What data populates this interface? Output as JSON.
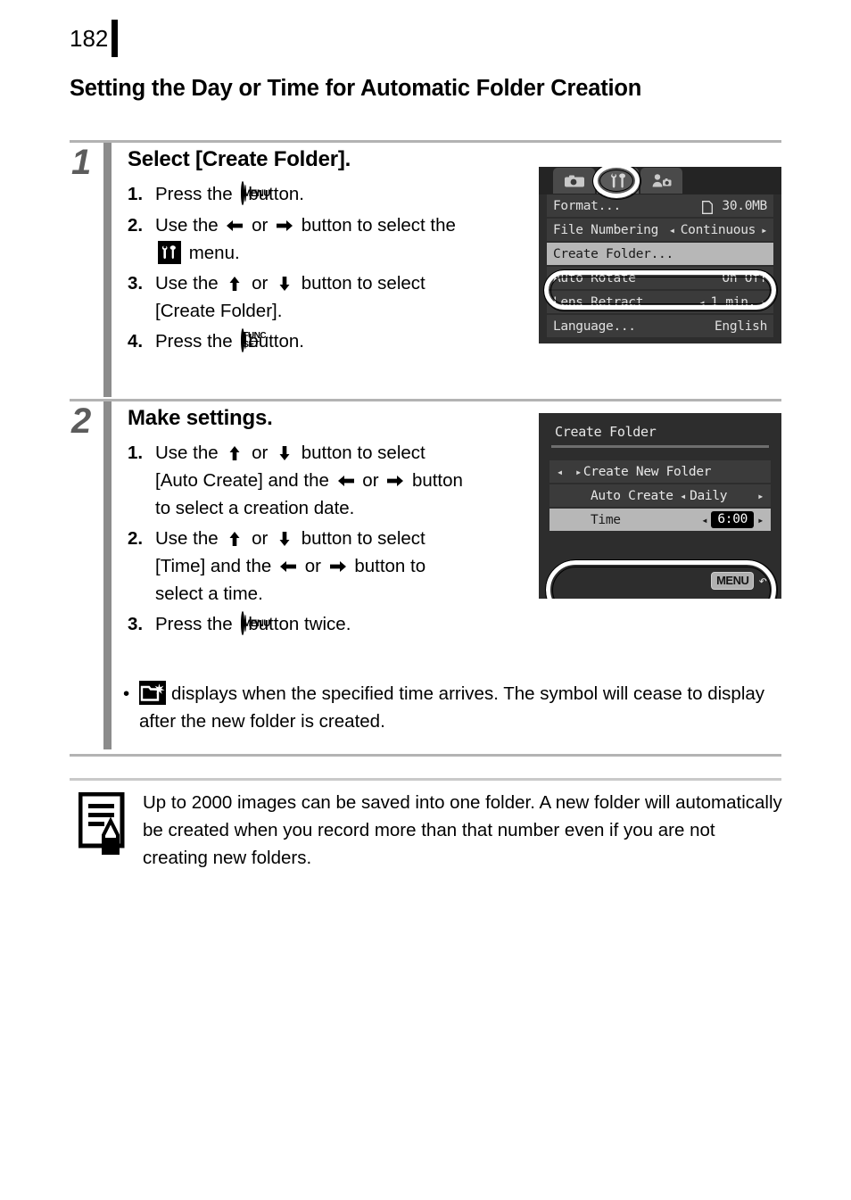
{
  "page": {
    "number": "182",
    "section_title": "Setting the Day or Time for Automatic Folder Creation"
  },
  "steps": [
    {
      "number": "1",
      "heading": "Select [Create Folder].",
      "substeps": [
        {
          "marker": "1.",
          "parts": [
            "Press the",
            "MENU-BUTTON",
            "button."
          ]
        },
        {
          "marker": "2.",
          "parts": [
            "Use the",
            "LEFT-ARROW",
            "or",
            "RIGHT-ARROW",
            "button to select the",
            "TOOL-MENU-ICON",
            "menu."
          ]
        },
        {
          "marker": "3.",
          "parts": [
            "Use the",
            "UP-ARROW",
            "or",
            "DOWN-ARROW",
            "button to select [Create Folder]."
          ]
        },
        {
          "marker": "4.",
          "parts": [
            "Press the",
            "FUNC-SET-BUTTON",
            "button."
          ]
        }
      ],
      "text": {
        "s1_a": "Press the",
        "s1_b": "button.",
        "s2_a": "Use the",
        "s2_or": "or",
        "s2_b": "button to select the",
        "s2_c": "menu.",
        "s3_a": "Use the",
        "s3_or": "or",
        "s3_b": "button to select",
        "s3_c": "[Create Folder].",
        "s4_a": "Press the",
        "s4_b": "button."
      }
    },
    {
      "number": "2",
      "heading": "Make settings.",
      "text": {
        "s1_a": "Use the",
        "s1_or": "or",
        "s1_b": "button to select",
        "s1_c": "[Auto Create] and the",
        "s1_or2": "or",
        "s1_d": "button",
        "s1_e": "to select a creation date.",
        "s2_a": "Use the",
        "s2_or": "or",
        "s2_b": "button to select",
        "s2_c": "[Time] and the",
        "s2_or2": "or",
        "s2_d": "button to",
        "s2_e": "select a time.",
        "s3_a": "Press the",
        "s3_b": "button twice."
      },
      "markers": {
        "m1": "1.",
        "m2": "2.",
        "m3": "3."
      }
    }
  ],
  "bullet_note": {
    "bullet": "•",
    "text": "displays when the specified time arrives. The symbol will cease to display after the new folder is created.",
    "icon": "folder-new-icon"
  },
  "note_block": {
    "icon": "memo-note-icon",
    "text": "Up to 2000 images can be saved into one folder. A new folder will automatically be created when you record more than that number even if you are not creating new folders."
  },
  "lcd_menu_screen": {
    "tabs": [
      {
        "name": "camera-tab",
        "icon": "camera-icon",
        "active": false
      },
      {
        "name": "settings-tab",
        "icon": "wrench-screwdriver-icon",
        "active": true
      },
      {
        "name": "my-camera-tab",
        "icon": "person-camera-icon",
        "active": false
      }
    ],
    "rows": [
      {
        "label": "Format...",
        "value": "30.0MB",
        "icon": "card-icon",
        "selected": false,
        "arrows": false
      },
      {
        "label": "File Numbering",
        "value": "Continuous",
        "selected": false,
        "arrows": true
      },
      {
        "label": "Create Folder...",
        "value": "",
        "selected": true,
        "arrows": false
      },
      {
        "label": "Auto Rotate",
        "value": "On Off",
        "selected": false,
        "arrows": false
      },
      {
        "label": "Lens Retract",
        "value": "1 min.",
        "selected": false,
        "arrows": true
      },
      {
        "label": "Language...",
        "value": "English",
        "selected": false,
        "arrows": false
      }
    ],
    "left_tri": "◂",
    "right_tri": "▸"
  },
  "lcd_settings_screen": {
    "title": "Create Folder",
    "option_row": {
      "label": "Create New Folder",
      "left_tri": "◂",
      "right_tri": "▸"
    },
    "rows": [
      {
        "label": "Auto Create",
        "value": "Daily",
        "left_tri": "◂",
        "right_tri": "▸",
        "highlight": false
      },
      {
        "label": "Time",
        "value": "6:00",
        "left_tri": "◂",
        "right_tri": "▸",
        "highlight": true
      }
    ],
    "menu_badge": "MENU",
    "back_arrow": "↶"
  }
}
